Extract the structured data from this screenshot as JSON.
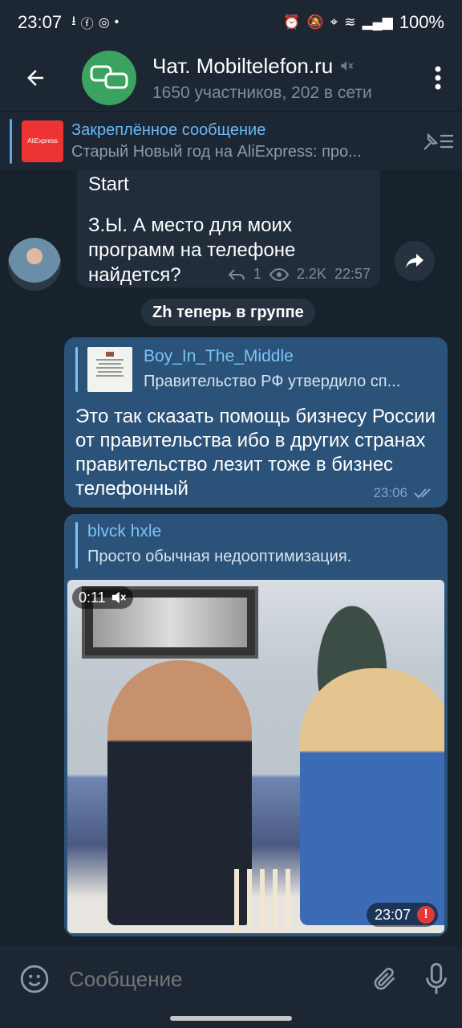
{
  "status_bar": {
    "time": "23:07",
    "battery": "100%"
  },
  "header": {
    "title": "Чат. Mobiltelefon.ru",
    "subtitle": "1650 участников, 202 в сети"
  },
  "pinned": {
    "label": "Закреплённое сообщение",
    "text": "Старый Новый год на AliExpress: про...",
    "thumb_text": "AliExpress"
  },
  "messages": {
    "incoming": {
      "text_clip": "Start",
      "text": "З.Ы. А место для моих программ на телефоне найдется?",
      "replies": "1",
      "views": "2.2K",
      "time": "22:57"
    },
    "service": "Zh теперь в группе",
    "outgoing1": {
      "reply_name": "Boy_In_The_Middle",
      "reply_text": "Правительство РФ утвердило сп...",
      "text": "Это так сказать помощь бизнесу России от правительства ибо в других странах правительство лезит тоже в бизнес телефонный",
      "time": "23:06"
    },
    "outgoing2": {
      "reply_name": "blvck hxle",
      "reply_text": "Просто обычная недооптимизация.",
      "video_duration": "0:11",
      "time": "23:07",
      "error_mark": "!"
    }
  },
  "input": {
    "placeholder": "Сообщение"
  },
  "colors": {
    "accent": "#5ea8e6",
    "outgoing_bubble": "#2b5278",
    "incoming_bubble": "#212d3b",
    "group_avatar": "#3aa35f",
    "error": "#e53935"
  }
}
